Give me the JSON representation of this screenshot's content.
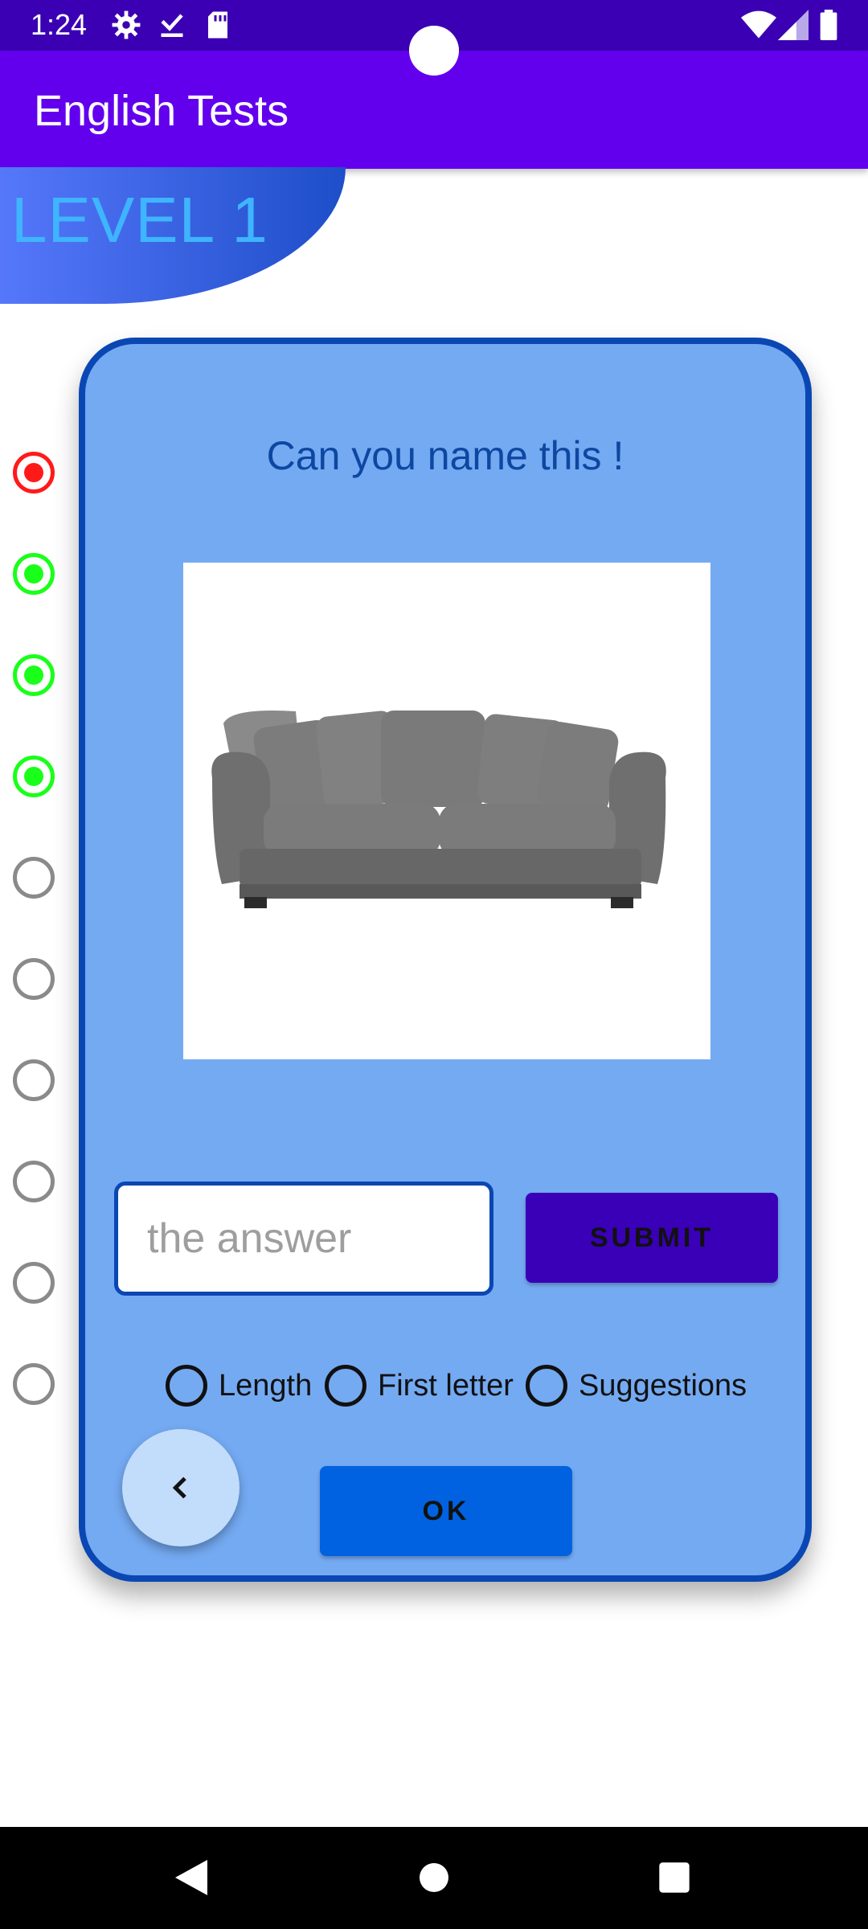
{
  "status_bar": {
    "time": "1:24",
    "icons_left": [
      "gear-icon",
      "download-done-icon",
      "sd-card-icon"
    ],
    "icons_right": [
      "wifi-icon",
      "signal-icon",
      "battery-icon"
    ]
  },
  "app_bar": {
    "title": "English Tests"
  },
  "level": {
    "label": "LEVEL 1"
  },
  "progress": {
    "items": [
      {
        "state": "wrong",
        "color": "#ff1a1a"
      },
      {
        "state": "correct",
        "color": "#1aff1a"
      },
      {
        "state": "correct",
        "color": "#1aff1a"
      },
      {
        "state": "correct",
        "color": "#1aff1a"
      },
      {
        "state": "pending"
      },
      {
        "state": "pending"
      },
      {
        "state": "pending"
      },
      {
        "state": "pending"
      },
      {
        "state": "pending"
      },
      {
        "state": "pending"
      }
    ]
  },
  "card": {
    "question": "Can you name this !",
    "image": "sofa-image",
    "answer": {
      "value": "",
      "placeholder": "the answer"
    },
    "submit_label": "SUBMIT",
    "hints": [
      {
        "label": "Length"
      },
      {
        "label": "First letter"
      },
      {
        "label": "Suggestions"
      }
    ],
    "back_icon": "chevron-left-icon",
    "ok_label": "OK"
  },
  "nav_bar": {
    "buttons": [
      "back-triangle-icon",
      "home-circle-icon",
      "recents-square-icon"
    ]
  },
  "colors": {
    "status_bar": "#3b00b3",
    "app_bar": "#6200ee",
    "card_bg": "#74aaf2",
    "card_border": "#0a47b3",
    "submit": "#3a00b8",
    "ok": "#0062e0"
  }
}
